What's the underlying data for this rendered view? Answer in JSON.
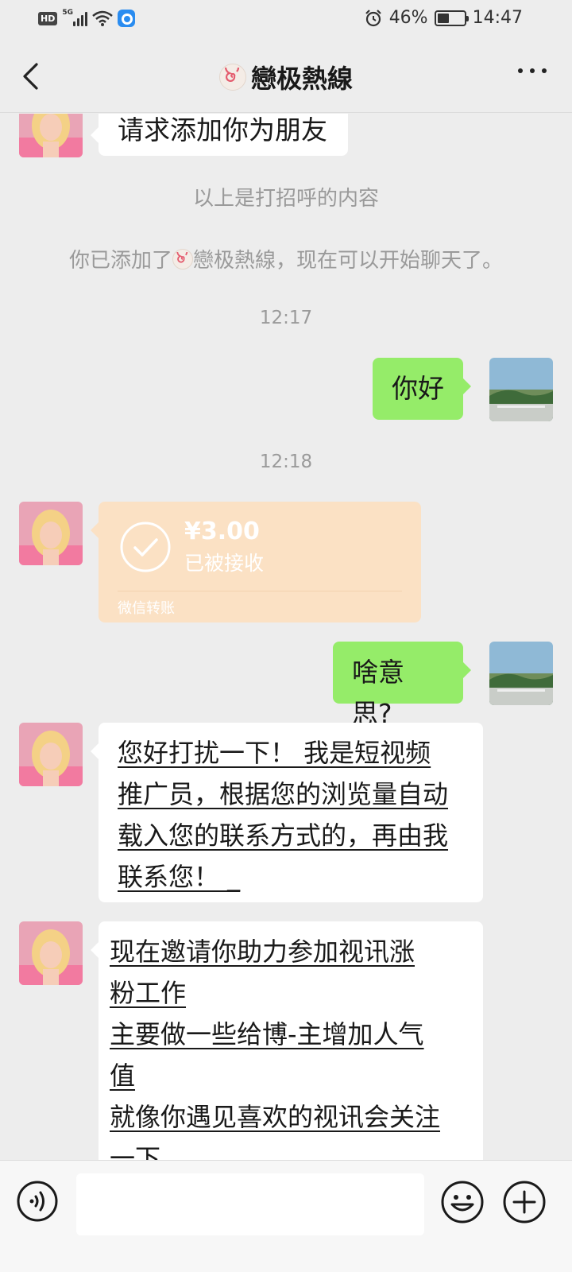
{
  "status_bar": {
    "hd": "HD",
    "network": "5G",
    "battery": "46%",
    "battery_level": 0.46,
    "time": "14:47"
  },
  "header": {
    "title": "戀极熱線"
  },
  "messages": {
    "m1": "请求添加你为朋友",
    "sys1": "以上是打招呼的内容",
    "sys2_prefix": "你已添加了",
    "sys2_name": "戀极熱線",
    "sys2_suffix": "，现在可以开始聊天了。",
    "ts1": "12:17",
    "m2": "你好",
    "ts2": "12:18",
    "transfer": {
      "amount": "¥3.00",
      "status": "已被接收",
      "footer": "微信转账"
    },
    "m3": "啥意思?",
    "m4": " 您好打扰一下！ 我是短视频\n推广员，根据您的浏览量自动\n载入您的联系方式的，再由我\n联系您！ _",
    "m5": " 现在邀请你助力参加视讯涨\n粉工作\n 主要做一些给博-主增加人气\n值\n 就像你遇见喜欢的视讯会关注\n一下"
  },
  "input": {
    "placeholder": ""
  },
  "icons": [
    "back-icon",
    "more-icon",
    "alarm-icon",
    "battery-icon",
    "voice-icon",
    "emoji-icon",
    "plus-icon",
    "check-icon"
  ],
  "colors": {
    "background": "#ededed",
    "green_bubble": "#95ec69",
    "transfer_card": "#fbe1c4"
  }
}
